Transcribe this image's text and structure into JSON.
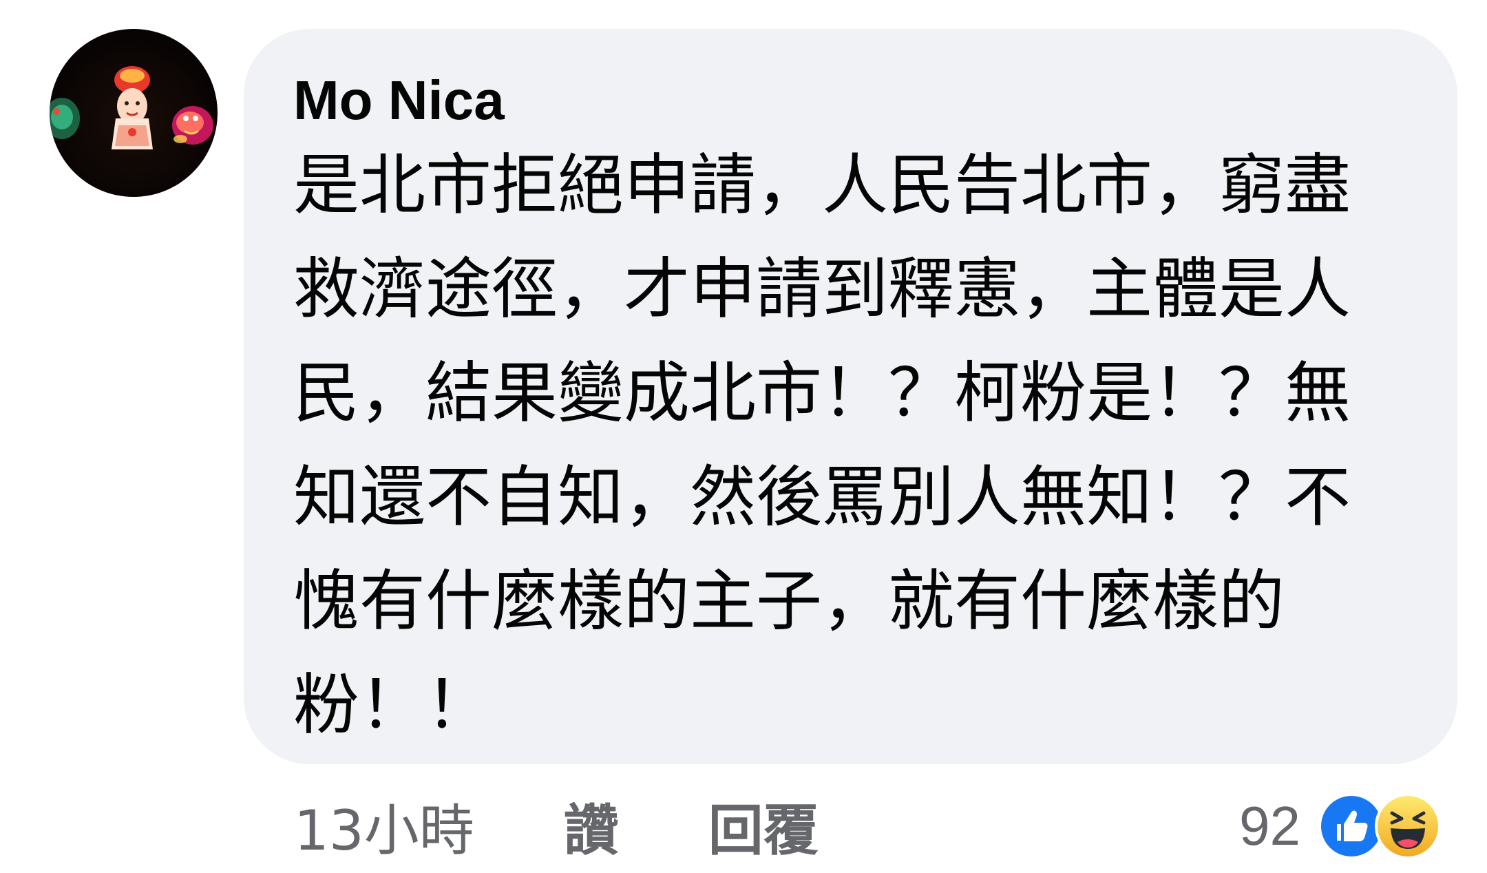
{
  "comment": {
    "author": "Mo Nica",
    "lines": [
      "是北市拒絕申請，人民告北市，窮盡",
      "救濟途徑，才申請到釋憲，主體是人",
      "民，結果變成北市！？柯粉是！？無",
      "知還不自知，然後罵別人無知！？不",
      "愧有什麼樣的主子，就有什麼樣的",
      "粉！！"
    ]
  },
  "actions": {
    "time": "13小時",
    "like": "讚",
    "reply": "回覆"
  },
  "reactions": {
    "count": "92",
    "icons": [
      "like-icon",
      "haha-icon"
    ],
    "like_color": "#1877f2",
    "haha_color": "#f7b125"
  },
  "colors": {
    "bubble": "#f0f2f5",
    "text": "#050505",
    "secondary": "#65676b"
  }
}
